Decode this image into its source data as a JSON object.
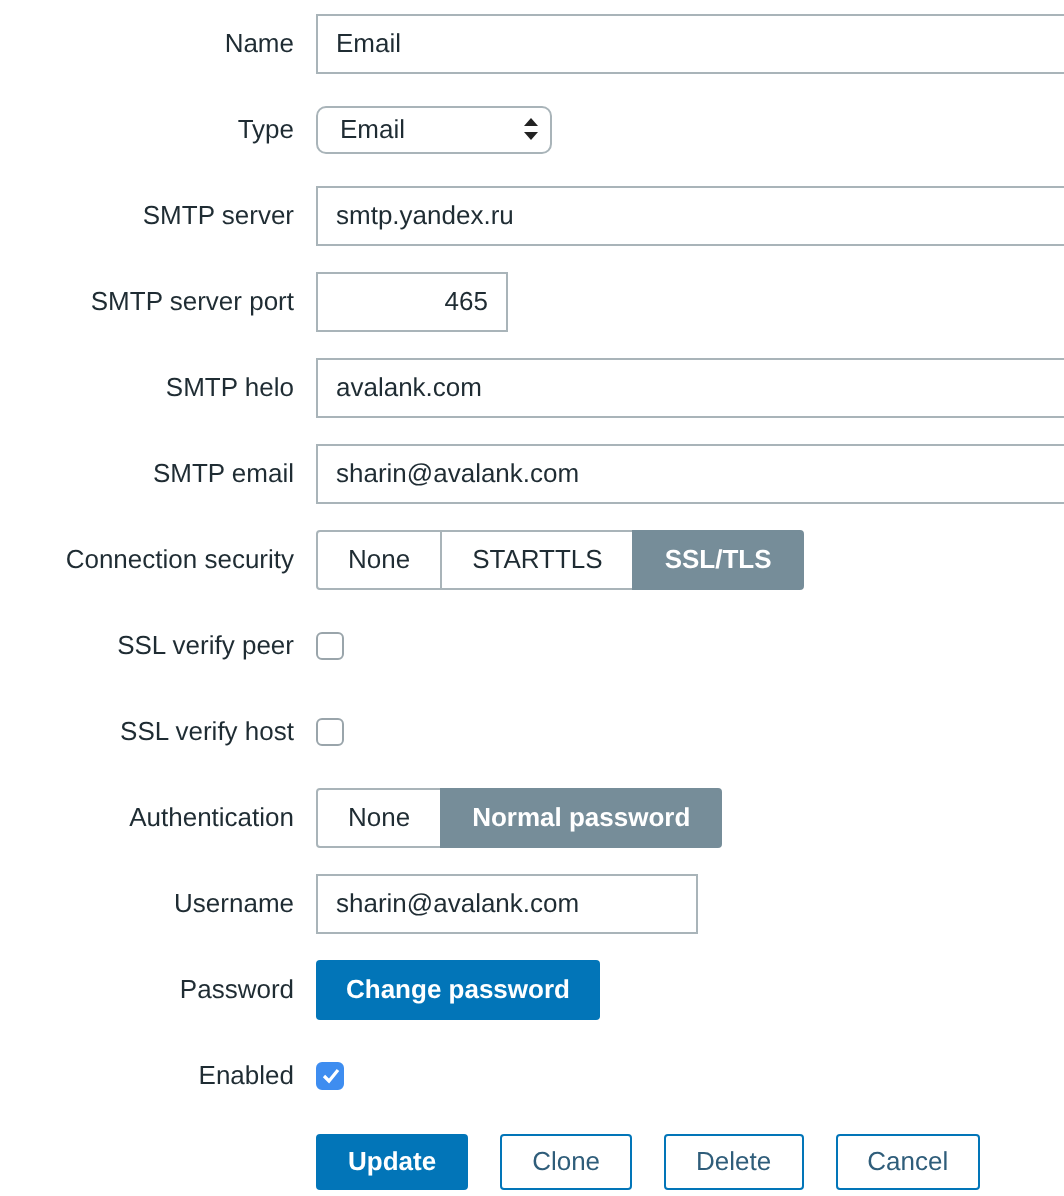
{
  "fields": [
    {
      "label": "Name",
      "kind": "text",
      "value": "Email"
    },
    {
      "label": "Type",
      "kind": "select",
      "value": "Email"
    },
    {
      "label": "SMTP server",
      "kind": "text",
      "value": "smtp.yandex.ru"
    },
    {
      "label": "SMTP server port",
      "kind": "number",
      "value": "465"
    },
    {
      "label": "SMTP helo",
      "kind": "text",
      "value": "avalank.com"
    },
    {
      "label": "SMTP email",
      "kind": "text",
      "value": "sharin@avalank.com"
    },
    {
      "label": "Connection security",
      "kind": "segmented",
      "options": [
        {
          "label": "None",
          "selected": false
        },
        {
          "label": "STARTTLS",
          "selected": false
        },
        {
          "label": "SSL/TLS",
          "selected": true
        }
      ]
    },
    {
      "label": "SSL verify peer",
      "kind": "checkbox",
      "checked": false
    },
    {
      "label": "SSL verify host",
      "kind": "checkbox",
      "checked": false
    },
    {
      "label": "Authentication",
      "kind": "segmented",
      "options": [
        {
          "label": "None",
          "selected": false
        },
        {
          "label": "Normal password",
          "selected": true
        }
      ]
    },
    {
      "label": "Username",
      "kind": "short",
      "value": "sharin@avalank.com"
    },
    {
      "label": "Password",
      "kind": "button",
      "button": "Change password"
    },
    {
      "label": "Enabled",
      "kind": "checkbox",
      "checked": true
    }
  ],
  "actions": [
    {
      "label": "Update",
      "primary": true
    },
    {
      "label": "Clone",
      "primary": false
    },
    {
      "label": "Delete",
      "primary": false
    },
    {
      "label": "Cancel",
      "primary": false
    }
  ]
}
